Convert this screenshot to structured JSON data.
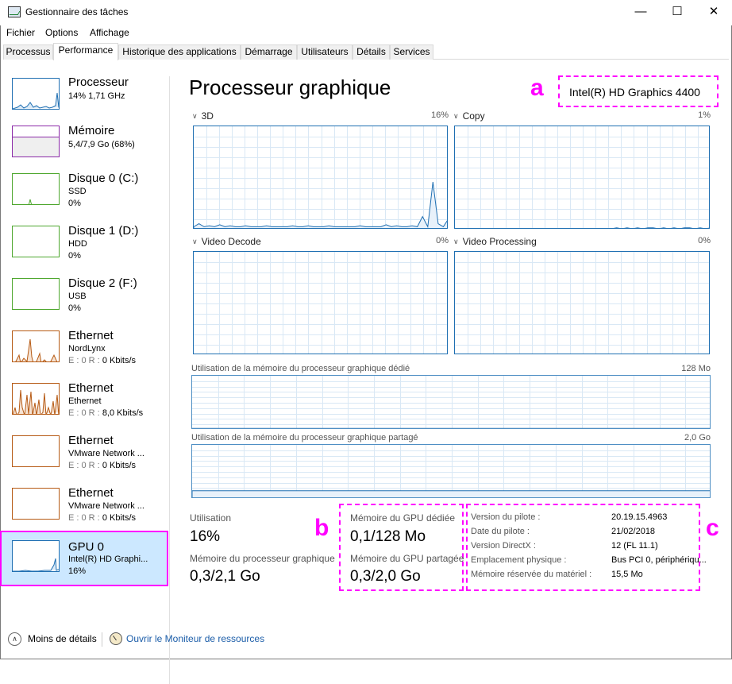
{
  "window": {
    "title": "Gestionnaire des tâches"
  },
  "menu": [
    "Fichier",
    "Options",
    "Affichage"
  ],
  "tabs": [
    "Processus",
    "Performance",
    "Historique des applications",
    "Démarrage",
    "Utilisateurs",
    "Détails",
    "Services"
  ],
  "active_tab": "Performance",
  "sidebar": [
    {
      "name": "Processeur",
      "line2": "14%  1,71 GHz",
      "line3": "",
      "color": "#1f6fb2"
    },
    {
      "name": "Mémoire",
      "line2": "5,4/7,9 Go (68%)",
      "line3": "",
      "color": "#8b2aa8"
    },
    {
      "name": "Disque 0 (C:)",
      "line2": "SSD",
      "line3": "0%",
      "color": "#4ea72e"
    },
    {
      "name": "Disque 1 (D:)",
      "line2": "HDD",
      "line3": "0%",
      "color": "#4ea72e"
    },
    {
      "name": "Disque 2 (F:)",
      "line2": "USB",
      "line3": "0%",
      "color": "#4ea72e"
    },
    {
      "name": "Ethernet",
      "line2": "NordLynx",
      "line3_label": "E : 0 R :",
      "line3": "0 Kbits/s",
      "color": "#b65a14"
    },
    {
      "name": "Ethernet",
      "line2": "Ethernet",
      "line3_label": "E : 0 R :",
      "line3": "8,0 Kbits/s",
      "color": "#b65a14"
    },
    {
      "name": "Ethernet",
      "line2": "VMware Network ...",
      "line3_label": "E : 0 R :",
      "line3": "0 Kbits/s",
      "color": "#b65a14"
    },
    {
      "name": "Ethernet",
      "line2": "VMware Network ...",
      "line3_label": "E : 0 R :",
      "line3": "0 Kbits/s",
      "color": "#b65a14"
    },
    {
      "name": "GPU 0",
      "line2": "Intel(R) HD Graphi...",
      "line3": "16%",
      "color": "#1f6fb2",
      "selected": true
    }
  ],
  "main": {
    "title": "Processeur graphique",
    "gpu_name": "Intel(R) HD Graphics 4400",
    "engines": [
      {
        "label": "3D",
        "pct": "16%"
      },
      {
        "label": "Copy",
        "pct": "1%"
      },
      {
        "label": "Video Decode",
        "pct": "0%"
      },
      {
        "label": "Video Processing",
        "pct": "0%"
      }
    ],
    "dedicated_mem_label": "Utilisation de la mémoire du processeur graphique dédié",
    "dedicated_mem_max": "128 Mo",
    "shared_mem_label": "Utilisation de la mémoire du processeur graphique partagé",
    "shared_mem_max": "2,0 Go"
  },
  "stats": {
    "utilisation_label": "Utilisation",
    "utilisation_value": "16%",
    "gpu_mem_label": "Mémoire du processeur graphique",
    "gpu_mem_value": "0,3/2,1 Go",
    "dedicated_label": "Mémoire du GPU dédiée",
    "dedicated_value": "0,1/128 Mo",
    "shared_label": "Mémoire du GPU partagée",
    "shared_value": "0,3/2,0 Go"
  },
  "driver_info": [
    {
      "label": "Version du pilote :",
      "value": "20.19.15.4963"
    },
    {
      "label": "Date du pilote :",
      "value": "21/02/2018"
    },
    {
      "label": "Version DirectX :",
      "value": "12 (FL 11.1)"
    },
    {
      "label": "Emplacement physique :",
      "value": "Bus PCI 0, périphériqu..."
    },
    {
      "label": "Mémoire réservée du matériel :",
      "value": "15,5 Mo"
    }
  ],
  "annotations": {
    "a": "a",
    "b": "b",
    "c": "c"
  },
  "footer": {
    "less_details": "Moins de détails",
    "resource_monitor": "Ouvrir le Moniteur de ressources"
  },
  "accent_color": "#ff00ff"
}
